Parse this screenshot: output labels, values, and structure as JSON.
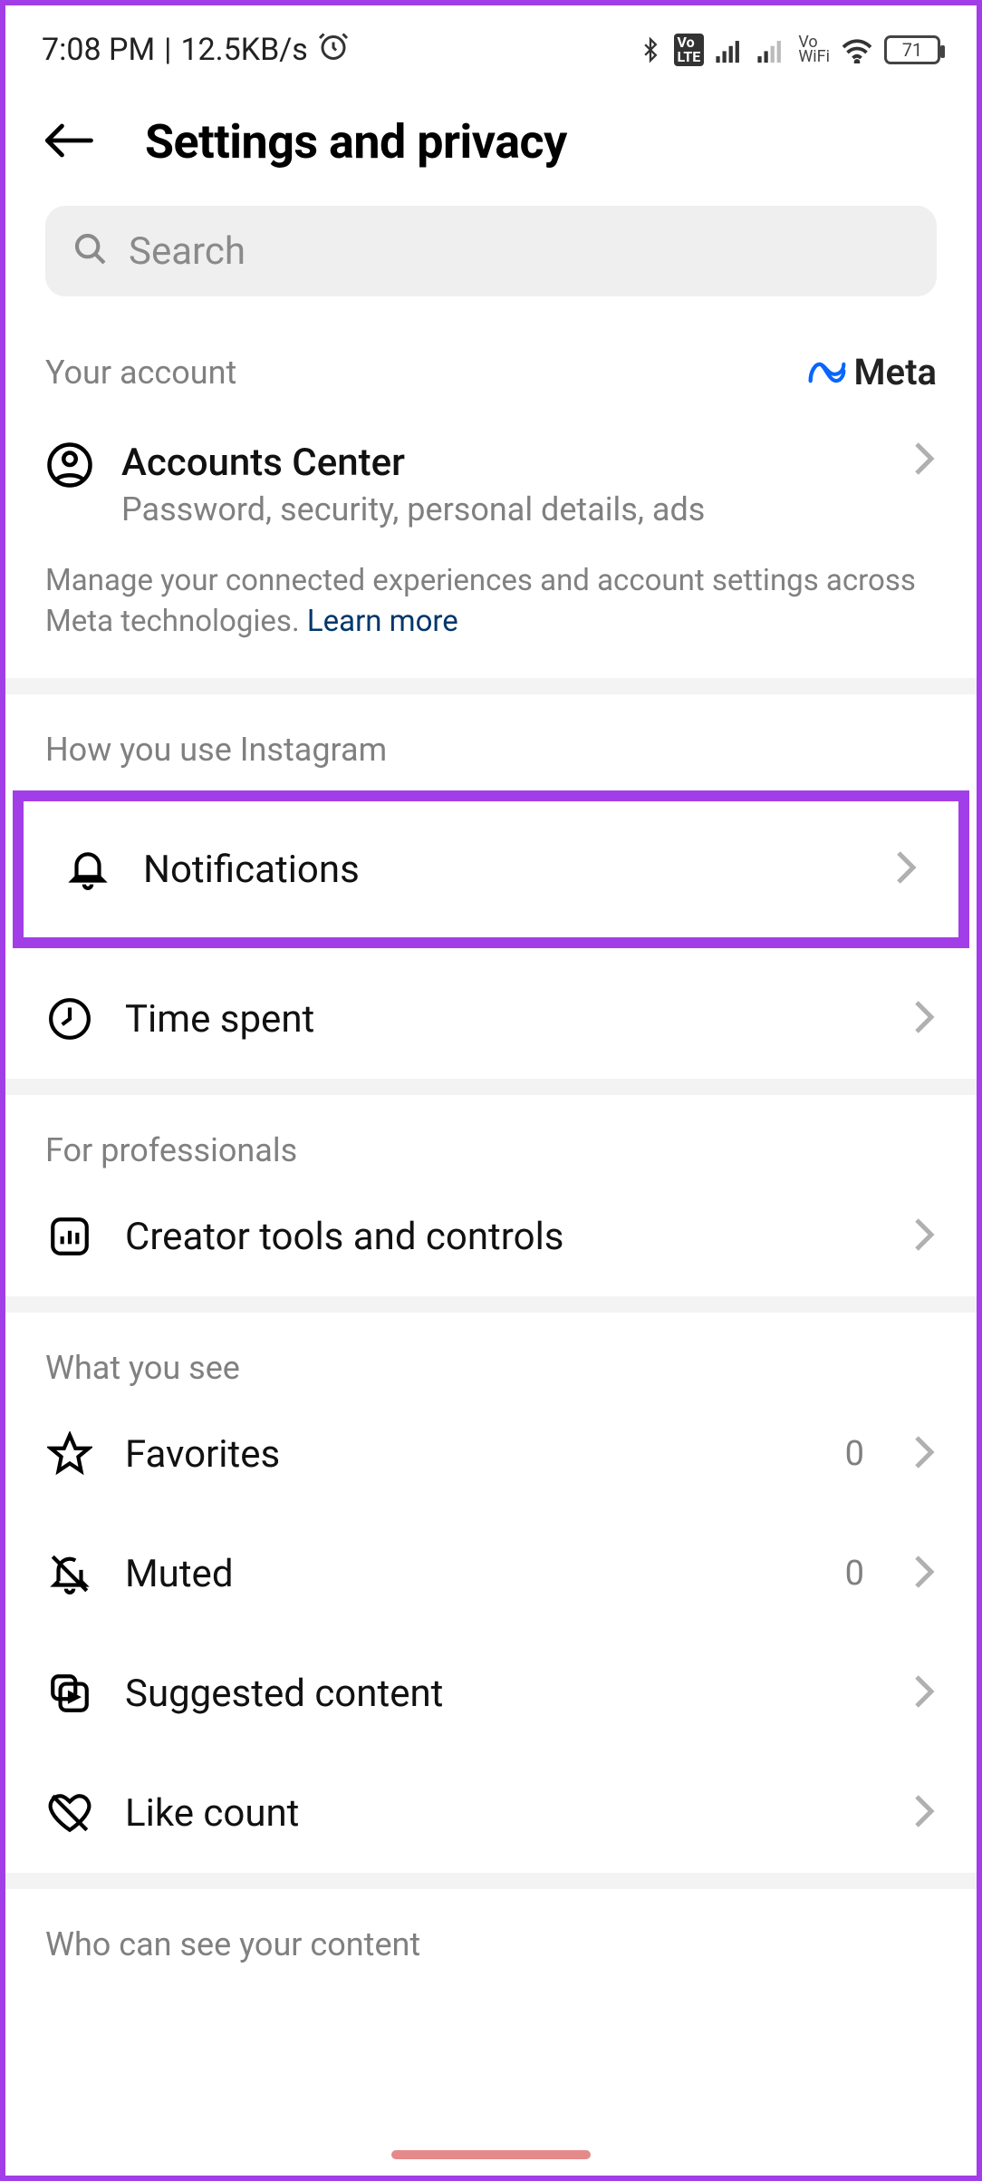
{
  "status": {
    "time": "7:08 PM",
    "netspeed": "12.5KB/s",
    "battery": "71"
  },
  "header": {
    "title": "Settings and privacy"
  },
  "search": {
    "placeholder": "Search"
  },
  "account_section": {
    "heading": "Your account",
    "brand": "Meta",
    "row": {
      "title": "Accounts Center",
      "subtitle": "Password, security, personal details, ads"
    },
    "info_text": "Manage your connected experiences and account settings across Meta technologies. ",
    "info_link": "Learn more"
  },
  "usage_section": {
    "heading": "How you use Instagram",
    "rows": {
      "notifications": "Notifications",
      "time_spent": "Time spent"
    }
  },
  "pro_section": {
    "heading": "For professionals",
    "rows": {
      "creator": "Creator tools and controls"
    }
  },
  "see_section": {
    "heading": "What you see",
    "rows": {
      "favorites": {
        "label": "Favorites",
        "count": "0"
      },
      "muted": {
        "label": "Muted",
        "count": "0"
      },
      "suggested": "Suggested content",
      "like_count": "Like count"
    }
  },
  "visibility_section": {
    "heading": "Who can see your content"
  }
}
